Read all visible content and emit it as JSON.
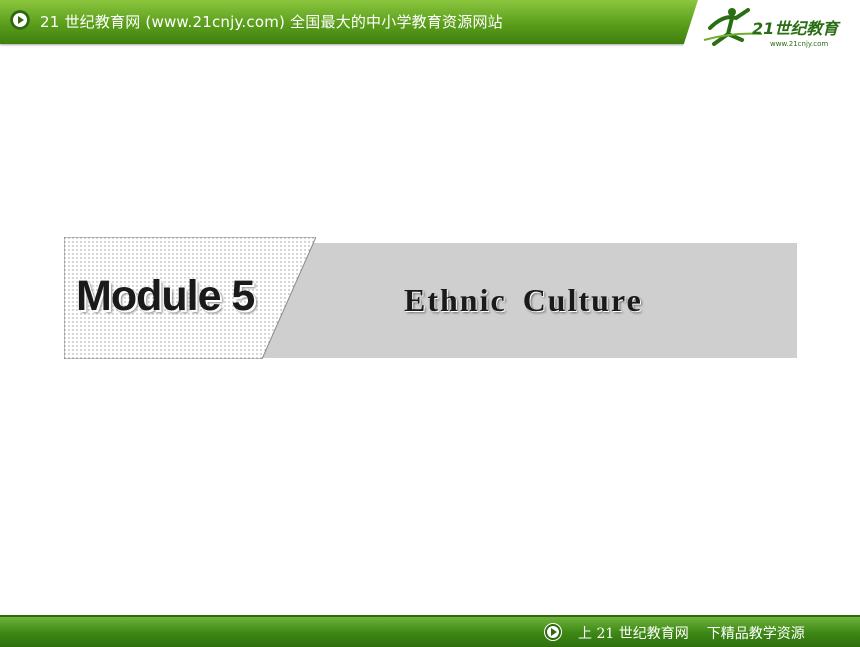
{
  "header": {
    "title": "21 世纪教育网 (www.21cnjy.com)  全国最大的中小学教育资源网站",
    "logo_text": "21世纪教育",
    "logo_url_text": "www.21cnjy.com"
  },
  "slide": {
    "module_label": "Module 5",
    "topic_title": "Ethnic  Culture"
  },
  "footer": {
    "left_text": "上 21 世纪教育网",
    "right_text": "下精品教学资源"
  },
  "colors": {
    "banner_green": "#5a9e1b",
    "band_gray": "#cfcfcf",
    "text_dark": "#1a1a1a"
  }
}
